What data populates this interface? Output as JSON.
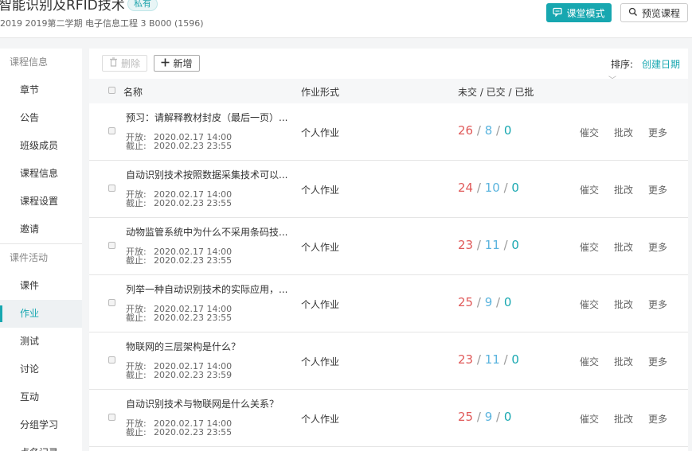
{
  "header": {
    "course_title": "智能识别及RFID技术",
    "private_badge": "私有",
    "course_subtitle": "2019 2019第二学期 电子信息工程 3 B000 (1596)",
    "classroom_mode_label": "课堂模式",
    "preview_label": "预览课程",
    "accent_color": "#17a7b0"
  },
  "sidebar": {
    "group1_label": "课程信息",
    "group1_items": [
      {
        "label": "章节"
      },
      {
        "label": "公告"
      },
      {
        "label": "班级成员"
      },
      {
        "label": "课程信息"
      },
      {
        "label": "课程设置"
      },
      {
        "label": "邀请"
      }
    ],
    "group2_label": "课件活动",
    "group2_items": [
      {
        "label": "课件"
      },
      {
        "label": "作业",
        "active": true
      },
      {
        "label": "测试"
      },
      {
        "label": "讨论"
      },
      {
        "label": "互动"
      },
      {
        "label": "分组学习"
      },
      {
        "label": "点名记录"
      }
    ]
  },
  "toolbar": {
    "delete_label": "删除",
    "add_label": "新增",
    "sort_label": "排序:",
    "sort_value": "创建日期"
  },
  "table": {
    "headers": {
      "name": "名称",
      "type": "作业形式",
      "stats": "未交 / 已交 / 已批"
    },
    "open_label": "开放:",
    "close_label": "截止:",
    "actions": {
      "remind": "催交",
      "grade": "批改",
      "more": "更多"
    },
    "rows": [
      {
        "title": "预习：请解释教材封皮（最后一页）...",
        "open": "2020.02.17 14:00",
        "close": "2020.02.23 23:55",
        "type": "个人作业",
        "unsubmitted": "26",
        "submitted": "8",
        "graded": "0"
      },
      {
        "title": "自动识别技术按照数据采集技术可以...",
        "open": "2020.02.17 14:00",
        "close": "2020.02.23 23:55",
        "type": "个人作业",
        "unsubmitted": "24",
        "submitted": "10",
        "graded": "0"
      },
      {
        "title": "动物监管系统中为什么不采用条码技...",
        "open": "2020.02.17 14:00",
        "close": "2020.02.23 23:55",
        "type": "个人作业",
        "unsubmitted": "23",
        "submitted": "11",
        "graded": "0"
      },
      {
        "title": "列举一种自动识别技术的实际应用，...",
        "open": "2020.02.17 14:00",
        "close": "2020.02.23 23:55",
        "type": "个人作业",
        "unsubmitted": "25",
        "submitted": "9",
        "graded": "0"
      },
      {
        "title": "物联网的三层架构是什么？",
        "open": "2020.02.17 14:00",
        "close": "2020.02.23 23:59",
        "type": "个人作业",
        "unsubmitted": "23",
        "submitted": "11",
        "graded": "0"
      },
      {
        "title": "自动识别技术与物联网是什么关系？",
        "open": "2020.02.17 14:00",
        "close": "2020.02.23 23:55",
        "type": "个人作业",
        "unsubmitted": "25",
        "submitted": "9",
        "graded": "0"
      }
    ]
  }
}
